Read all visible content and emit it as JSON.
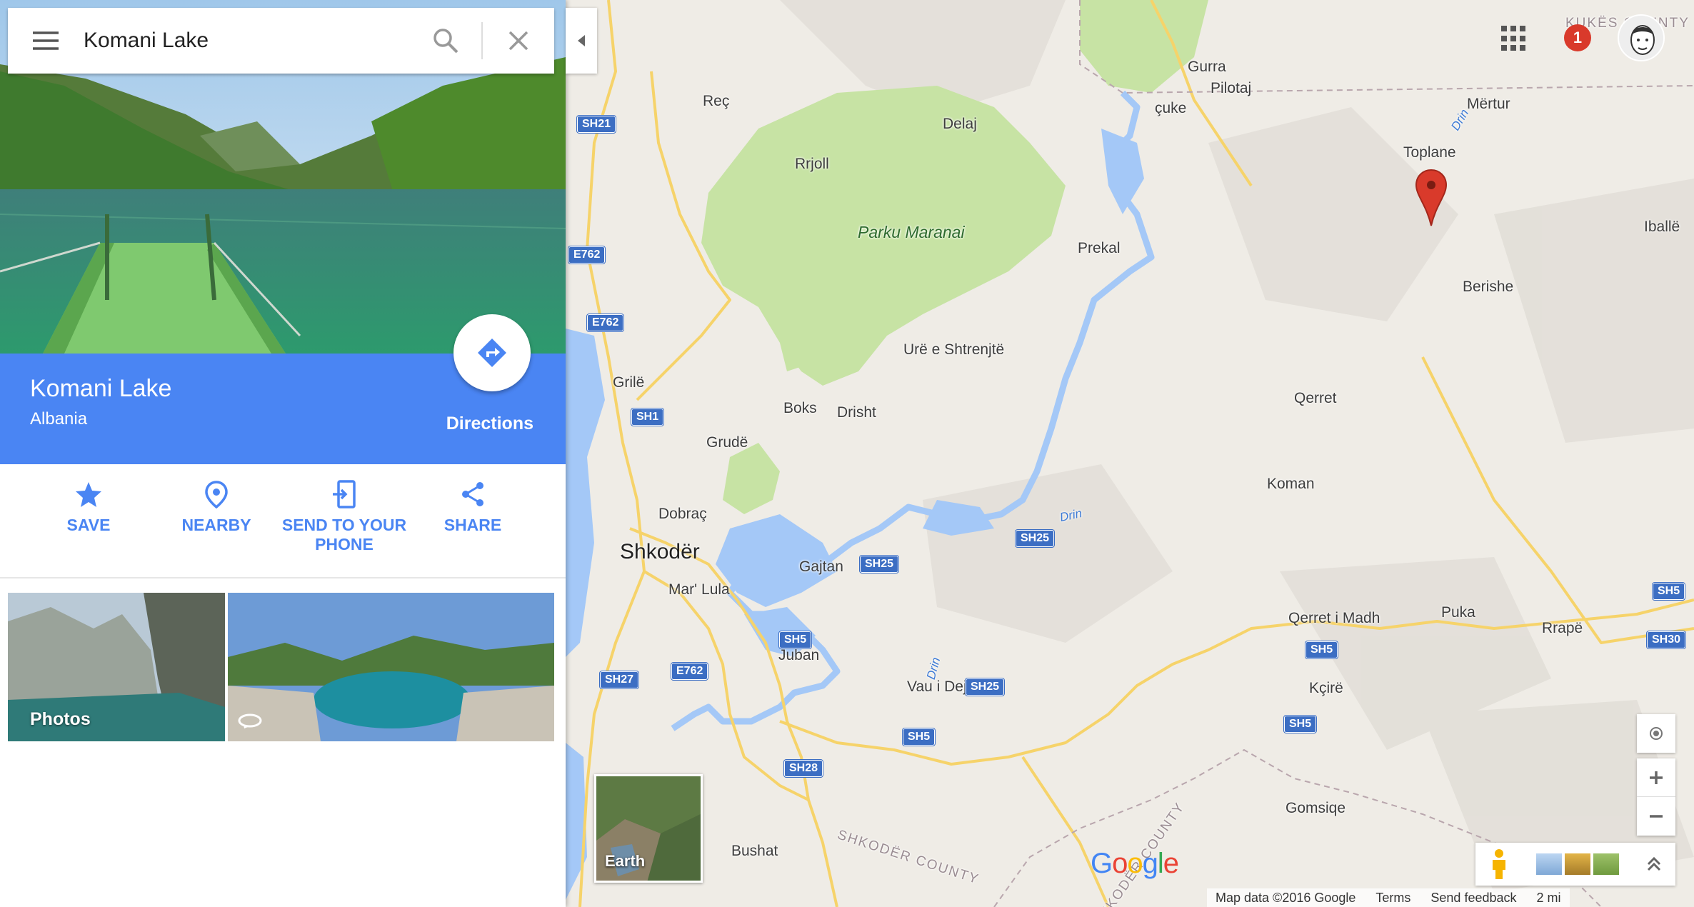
{
  "search": {
    "query": "Komani Lake"
  },
  "place": {
    "name": "Komani Lake",
    "region": "Albania",
    "directions_label": "Directions"
  },
  "actions": [
    {
      "label": "SAVE",
      "icon": "star-icon"
    },
    {
      "label": "NEARBY",
      "icon": "nearby-pin-icon"
    },
    {
      "label": "SEND TO YOUR PHONE",
      "icon": "send-to-phone-icon"
    },
    {
      "label": "SHARE",
      "icon": "share-icon"
    }
  ],
  "photos": {
    "photos_label": "Photos",
    "pano_icon": "360-view-icon"
  },
  "map": {
    "earth_label": "Earth",
    "notification_count": "1",
    "logo": "Google",
    "footer": {
      "map_data": "Map data ©2016 Google",
      "terms": "Terms",
      "feedback": "Send feedback",
      "scale": "2 mi"
    },
    "colors": {
      "water": "#a4c8f7",
      "park": "#c7e3a4",
      "road": "#f6d36a",
      "land": "#efece6",
      "accent": "#4a85f3",
      "pin": "#d93a2b"
    },
    "places": {
      "gurra": "Gurra",
      "pilotaj": "Pilotaj",
      "cuke": "çuke",
      "mertur": "Mërtur",
      "toplane": "Toplane",
      "ibalie": "Iballë",
      "berishe": "Berishe",
      "rec": "Reç",
      "delaj": "Delaj",
      "rrjoll": "Rrjoll",
      "parku": "Parku Maranai",
      "prekal": "Prekal",
      "ure": "Urë e Shtrenjtë",
      "grile": "Grilë",
      "boks": "Boks",
      "drisht": "Drisht",
      "grude": "Grudë",
      "qerret": "Qerret",
      "koman": "Koman",
      "dobrac": "Dobraç",
      "shkoder": "Shkodër",
      "gajtan": "Gajtan",
      "mar_lula": "Mar' Lula",
      "juban": "Juban",
      "qerret_madh": "Qerret i Madh",
      "puka": "Puka",
      "rrape": "Rrapë",
      "kcire": "Kçirë",
      "vau": "Vau i Dejës",
      "gomsiqe": "Gomsiqe",
      "bushat": "Bushat",
      "county1": "SHKODËR COUNTY",
      "county2": "SHKODËR COUNTY",
      "county3": "KUKËS COUNTY",
      "drin1": "Drin",
      "drin2": "Drin",
      "drin3": "Drin"
    },
    "shields": {
      "sh21": "SH21",
      "e762a": "E762",
      "e762b": "E762",
      "sh1": "SH1",
      "sh25a": "SH25",
      "sh25b": "SH25",
      "sh25c": "SH25",
      "sh5a": "SH5",
      "sh5b": "SH5",
      "sh5c": "SH5",
      "sh5d": "SH5",
      "sh5e": "SH5",
      "sh30": "SH30",
      "sh27": "SH27",
      "e762c": "E762",
      "sh28": "SH28"
    }
  }
}
